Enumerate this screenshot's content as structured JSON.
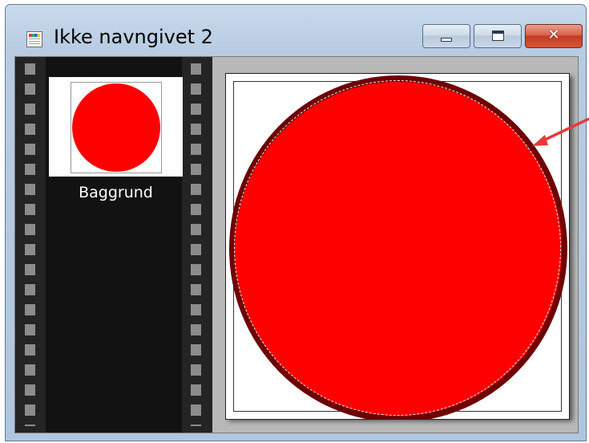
{
  "window": {
    "title": "Ikke navngivet 2",
    "icon": "document-icon",
    "controls": {
      "minimize": "minimize-icon",
      "maximize": "maximize-icon",
      "close": "close-icon",
      "close_glyph": "✕"
    }
  },
  "layers": [
    {
      "label": "Baggrund",
      "thumbnail_color": "#ff0000"
    }
  ],
  "canvas": {
    "shape": "circle",
    "fill_color": "#ff0000",
    "ring_color": "#6e0000",
    "selection": "dashed-ellipse"
  },
  "annotation": {
    "arrow_color": "#e83a3a",
    "icon": "arrow-icon"
  }
}
